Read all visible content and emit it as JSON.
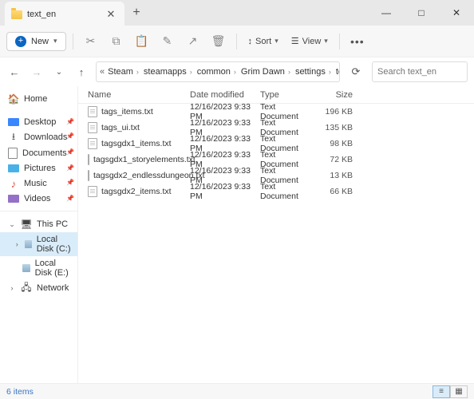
{
  "window": {
    "tab_title": "text_en",
    "minimize": "—",
    "maximize": "□",
    "close": "✕"
  },
  "toolbar": {
    "new_label": "New",
    "sort_label": "Sort",
    "view_label": "View"
  },
  "breadcrumb": {
    "items": [
      "Steam",
      "steamapps",
      "common",
      "Grim Dawn",
      "settings",
      "text_en"
    ]
  },
  "search": {
    "placeholder": "Search text_en"
  },
  "sidebar": {
    "home": "Home",
    "quick": [
      {
        "label": "Desktop"
      },
      {
        "label": "Downloads"
      },
      {
        "label": "Documents"
      },
      {
        "label": "Pictures"
      },
      {
        "label": "Music"
      },
      {
        "label": "Videos"
      }
    ],
    "pc_label": "This PC",
    "drives": [
      {
        "label": "Local Disk (C:)",
        "selected": true
      },
      {
        "label": "Local Disk (E:)",
        "selected": false
      }
    ],
    "network_label": "Network"
  },
  "columns": {
    "name": "Name",
    "date": "Date modified",
    "type": "Type",
    "size": "Size"
  },
  "files": [
    {
      "name": "tags_items.txt",
      "date": "12/16/2023 9:33 PM",
      "type": "Text Document",
      "size": "196 KB"
    },
    {
      "name": "tags_ui.txt",
      "date": "12/16/2023 9:33 PM",
      "type": "Text Document",
      "size": "135 KB"
    },
    {
      "name": "tagsgdx1_items.txt",
      "date": "12/16/2023 9:33 PM",
      "type": "Text Document",
      "size": "98 KB"
    },
    {
      "name": "tagsgdx1_storyelements.txt",
      "date": "12/16/2023 9:33 PM",
      "type": "Text Document",
      "size": "72 KB"
    },
    {
      "name": "tagsgdx2_endlessdungeon.txt",
      "date": "12/16/2023 9:33 PM",
      "type": "Text Document",
      "size": "13 KB"
    },
    {
      "name": "tagsgdx2_items.txt",
      "date": "12/16/2023 9:33 PM",
      "type": "Text Document",
      "size": "66 KB"
    }
  ],
  "status": {
    "count_label": "6 items"
  }
}
